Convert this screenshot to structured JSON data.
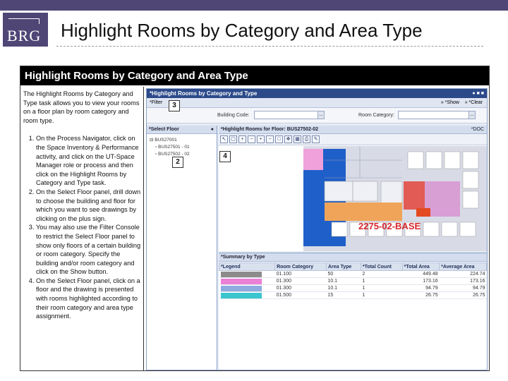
{
  "slide": {
    "logo_text": "BRG",
    "title": "Highlight Rooms by Category and Area Type"
  },
  "frame": {
    "header": "Highlight Rooms by Category and Area Type",
    "intro": "The Highlight Rooms by Category and Type task allows you to view your rooms on a floor plan by room category and room type.",
    "steps": [
      "On the Process Navigator, click on the Space Inventory & Performance activity, and click on the UT-Space Manager role or process and then click on the Highlight Rooms by Category and Type task.",
      "On the Select Floor panel, drill down to choose the building and floor for which you want to see drawings by clicking on the plus sign.",
      "You may also use the Filter Console to restrict the Select Floor panel to show only floors of a certain building or room category. Specify the building and/or room category and click on the Show button.",
      "On the Select Floor panel, click on a floor and the drawing is presented with rooms highlighted according to their room category and area type assignment."
    ]
  },
  "app": {
    "title": "*Highlight Rooms by Category and Type",
    "title_controls": "● ■ ■",
    "filter_label": "*Filter",
    "show_label": "*Show",
    "clear_label": "*Clear",
    "building_code_label": "Building Code:",
    "room_category_label": "Room Category:",
    "select_floor_title": "*Select Floor",
    "tree_items": [
      "BUS27001",
      "BUS27501 - 01",
      "BUS27502 - 02"
    ],
    "plan_panel_title": "*Highlight Rooms for Floor: BUS27502-02",
    "plan_panel_action": "*DOC",
    "plan_label": "2275-02-BASE",
    "summary_title": "*Summary by Type",
    "summary_columns": [
      "*Legend",
      "Room Category",
      "Area Type",
      "*Total Count",
      "*Total Area",
      "*Average Area"
    ],
    "summary_rows": [
      {
        "category": "01.100",
        "area_type": "50",
        "count": "2",
        "total": "449.48",
        "average": "224.74"
      },
      {
        "category": "01.300",
        "area_type": "10.1",
        "count": "1",
        "total": "173.16",
        "average": "173.16"
      },
      {
        "category": "01.300",
        "area_type": "10.1",
        "count": "1",
        "total": "94.79",
        "average": "94.79"
      },
      {
        "category": "01.500",
        "area_type": "15",
        "count": "1",
        "total": "26.75",
        "average": "26.75"
      }
    ]
  },
  "callouts": [
    "2",
    "3",
    "4"
  ],
  "colors": {
    "brand": "#4f4676",
    "app_title": "#2c4a8a",
    "legend": [
      "#8d8b8b",
      "#ec7fd6",
      "#8eaadf",
      "#3bc5ce"
    ]
  }
}
